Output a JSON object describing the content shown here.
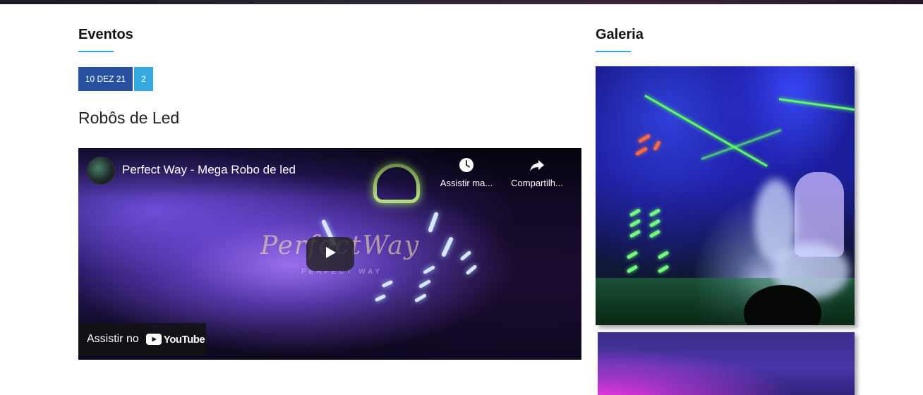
{
  "events": {
    "heading": "Eventos",
    "date_badge": "10 DEZ 21",
    "count_badge": "2",
    "event_title": "Robôs de Led",
    "video": {
      "title": "Perfect Way - Mega Robo de led",
      "watch_later_label": "Assistir ma...",
      "share_label": "Compartilh...",
      "watch_on_label": "Assistir no",
      "youtube_brand": "YouTube",
      "watermark": "PerfectWay",
      "watermark_sub": "PERFECT WAY"
    }
  },
  "gallery": {
    "heading": "Galeria"
  },
  "colors": {
    "accent": "#2fa7e0",
    "date_badge_bg": "#27509f",
    "count_badge_bg": "#37a9e1"
  }
}
